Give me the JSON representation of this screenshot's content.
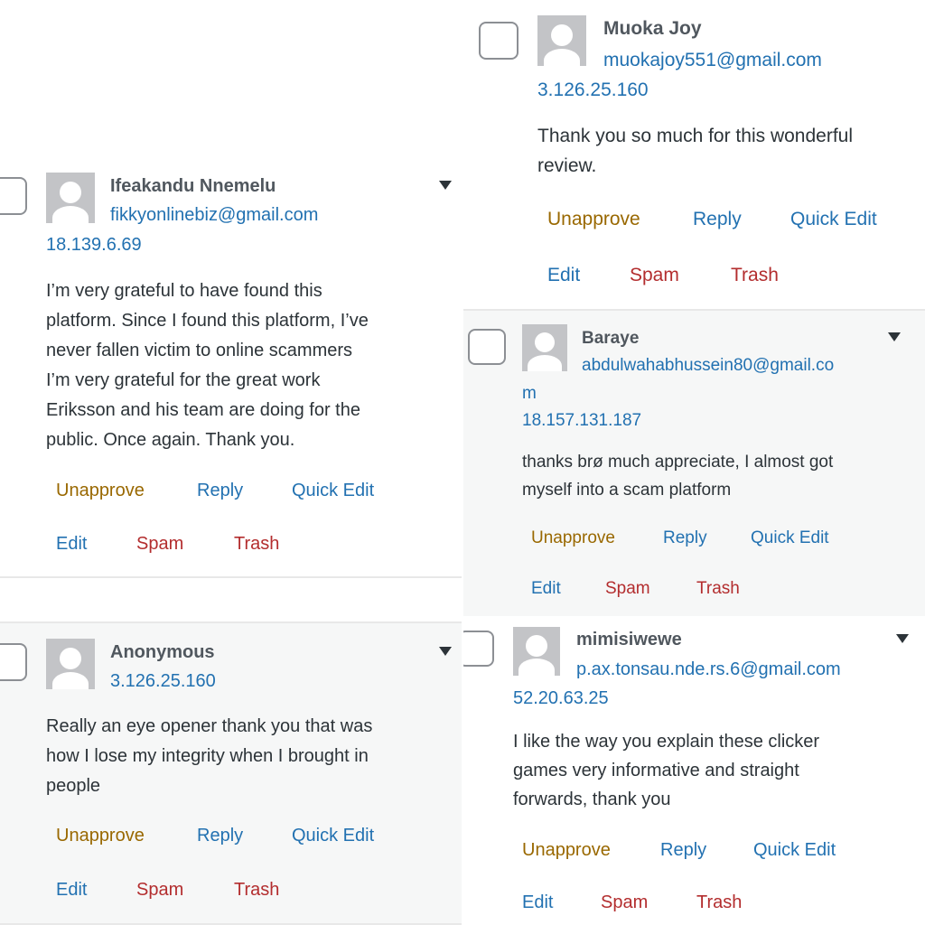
{
  "comments": [
    {
      "author": "Muoka Joy",
      "email": "muokajoy551@gmail.com",
      "ip": "3.126.25.160",
      "text_lines": [
        "Thank you so much for this wonderful",
        "review."
      ],
      "actions": {
        "unapprove": "Unapprove",
        "reply": "Reply",
        "quick_edit": "Quick Edit",
        "edit": "Edit",
        "spam": "Spam",
        "trash": "Trash"
      }
    },
    {
      "author": "Ifeakandu Nnemelu",
      "email": "fikkyonlinebiz@gmail.com",
      "ip": "18.139.6.69",
      "text_lines": [
        "I’m very grateful to have found this",
        "platform. Since I found this platform, I’ve",
        "never fallen victim to online scammers",
        "I’m very grateful for the great work",
        "Eriksson and his team are doing for the",
        "public. Once again. Thank you."
      ],
      "actions": {
        "unapprove": "Unapprove",
        "reply": "Reply",
        "quick_edit": "Quick Edit",
        "edit": "Edit",
        "spam": "Spam",
        "trash": "Trash"
      }
    },
    {
      "author": "Baraye",
      "email_lines": [
        "abdulwahabhussein80@gmail.co",
        "m"
      ],
      "ip": "18.157.131.187",
      "text_lines": [
        "thanks brø much appreciate, I almost got",
        "myself into a scam platform"
      ],
      "actions": {
        "unapprove": "Unapprove",
        "reply": "Reply",
        "quick_edit": "Quick Edit",
        "edit": "Edit",
        "spam": "Spam",
        "trash": "Trash"
      }
    },
    {
      "author": "Anonymous",
      "ip": "3.126.25.160",
      "text_lines": [
        "Really an eye opener thank you that was",
        "how I lose my integrity when I brought in",
        "people"
      ],
      "actions": {
        "unapprove": "Unapprove",
        "reply": "Reply",
        "quick_edit": "Quick Edit",
        "edit": "Edit",
        "spam": "Spam",
        "trash": "Trash"
      }
    },
    {
      "author": "mimisiwewe",
      "email": "p.ax.tonsau.nde.rs.6@gmail.com",
      "ip": "52.20.63.25",
      "text_lines": [
        "I like the way you explain these clicker",
        "games very informative and straight",
        "forwards, thank you"
      ],
      "actions": {
        "unapprove": "Unapprove",
        "reply": "Reply",
        "quick_edit": "Quick Edit",
        "edit": "Edit",
        "spam": "Spam",
        "trash": "Trash"
      }
    }
  ],
  "colors": {
    "link": "#2271b1",
    "unapprove": "#996800",
    "delete": "#b32d2e",
    "row_alt": "#f6f7f7"
  },
  "icons": {
    "avatar": "default-avatar-icon",
    "row_toggle": "caret-down-icon",
    "select": "checkbox"
  }
}
